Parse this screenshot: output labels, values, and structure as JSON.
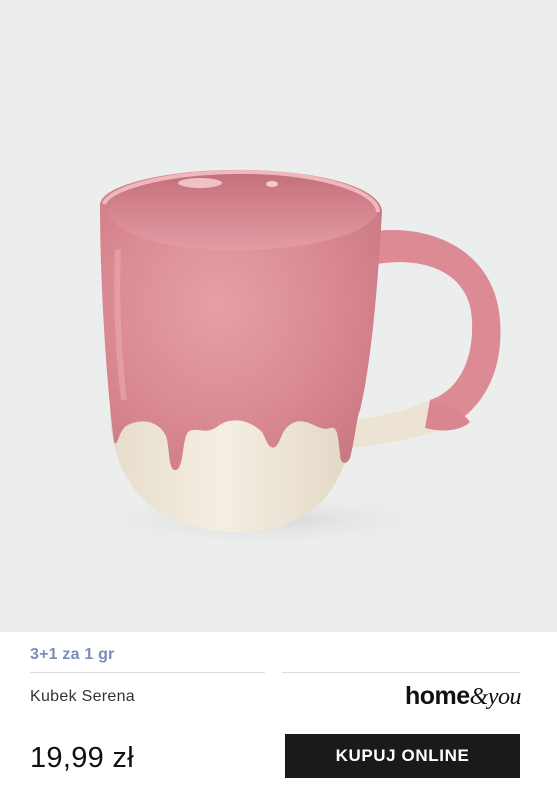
{
  "product": {
    "promo_label": "3+1 za 1 gr",
    "name": "Kubek Serena",
    "price": "19,99 zł",
    "image_icon": "mug-image"
  },
  "brand": {
    "part1": "home",
    "part2": "&you"
  },
  "actions": {
    "buy_label": "KUPUJ ONLINE"
  },
  "colors": {
    "mug_pink": "#d8848d",
    "mug_cream": "#efe7d9",
    "background": "#eceded",
    "promo": "#7a8db5",
    "button": "#1a1a1a"
  }
}
